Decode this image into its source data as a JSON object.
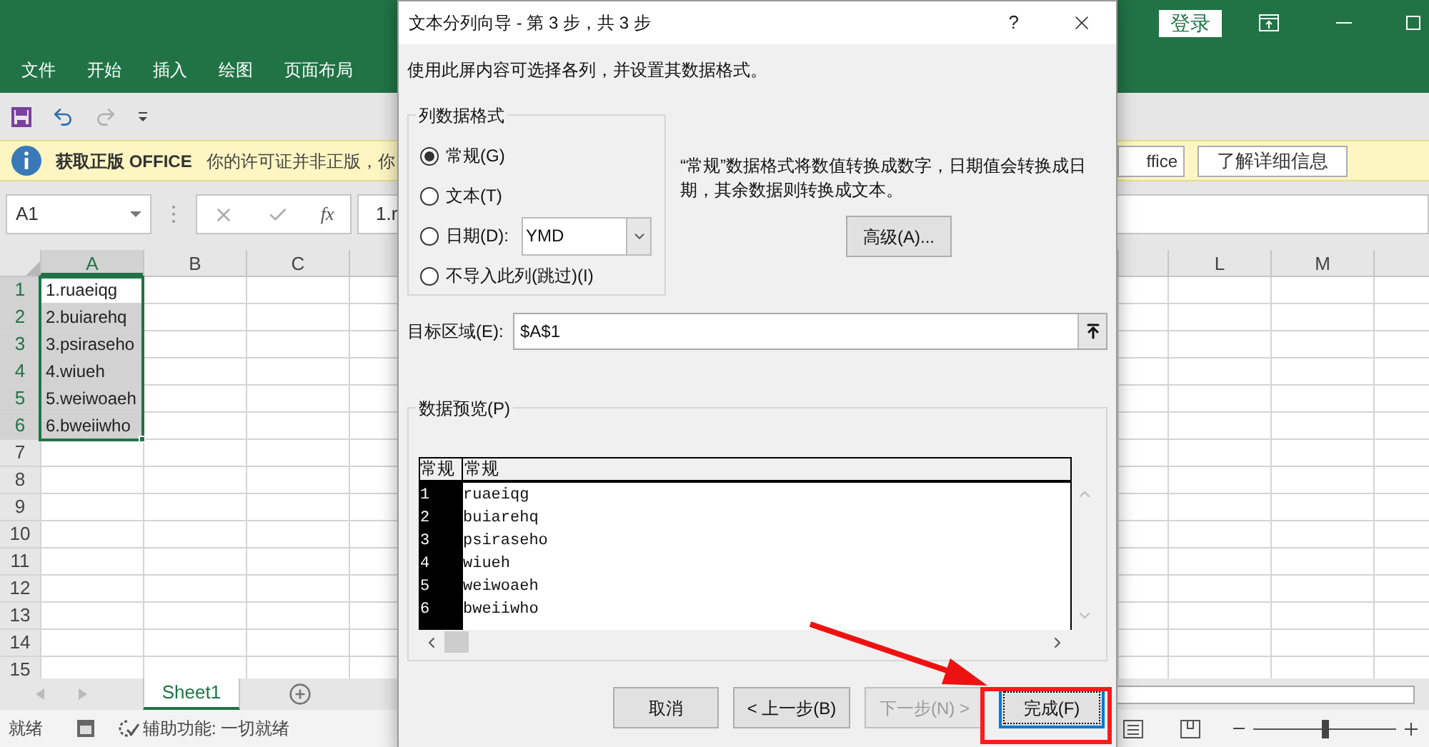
{
  "excel": {
    "title_bar": {
      "signin": "登录"
    },
    "ribbon_tabs": [
      "文件",
      "开始",
      "插入",
      "绘图",
      "页面布局"
    ],
    "message_bar": {
      "title": "获取正版 OFFICE",
      "text": "你的许可证并非正版，你",
      "buttons": [
        "ffice",
        "了解详细信息"
      ]
    },
    "name_box": "A1",
    "fx": "fx",
    "formula": "1.r",
    "columns_left": [
      "A",
      "B",
      "C"
    ],
    "columns_right": [
      "L",
      "M"
    ],
    "rows": [
      {
        "label": "1",
        "cell": {
          "text": "1.ruaeiqg",
          "selected": false
        }
      },
      {
        "label": "2",
        "cell": {
          "text": "2.buiarehq",
          "selected": true
        }
      },
      {
        "label": "3",
        "cell": {
          "text": "3.psiraseho",
          "selected": true
        }
      },
      {
        "label": "4",
        "cell": {
          "text": "4.wiueh",
          "selected": true
        }
      },
      {
        "label": "5",
        "cell": {
          "text": "5.weiwoaeh",
          "selected": true
        }
      },
      {
        "label": "6",
        "cell": {
          "text": "6.bweiiwho",
          "selected": true
        }
      },
      {
        "label": "7"
      },
      {
        "label": "8"
      },
      {
        "label": "9"
      },
      {
        "label": "10"
      },
      {
        "label": "11"
      },
      {
        "label": "12"
      },
      {
        "label": "13"
      },
      {
        "label": "14"
      },
      {
        "label": "15"
      }
    ],
    "sheet_tabs": [
      {
        "label": "Sheet1",
        "selected": true
      }
    ],
    "status": {
      "ready": "就绪",
      "accessibility": "辅助功能: 一切就绪"
    },
    "zoom": {
      "level": 0.5
    }
  },
  "dialog": {
    "title": "文本分列向导 - 第 3 步，共 3 步",
    "help": "?",
    "instruction": "使用此屏内容可选择各列，并设置其数据格式。",
    "format_group": {
      "label": "列数据格式",
      "options": [
        {
          "kind": "plain",
          "label": "常规(G)",
          "selected": true
        },
        {
          "kind": "plain",
          "label": "文本(T)",
          "selected": false
        },
        {
          "kind": "date",
          "label": "日期(D):",
          "selected": false,
          "value": "YMD"
        },
        {
          "kind": "plain",
          "label": "不导入此列(跳过)(I)",
          "selected": false
        }
      ]
    },
    "description": "“常规”数据格式将数值转换成数字，日期值会转换成日期，其余数据则转换成文本。",
    "advanced": "高级(A)...",
    "destination": {
      "label": "目标区域(E):",
      "value": "$A$1"
    },
    "preview": {
      "label": "数据预览(P)",
      "headers": [
        "常规",
        "常规"
      ],
      "rows": [
        {
          "num": "1",
          "value": "ruaeiqg"
        },
        {
          "num": "2",
          "value": "buiarehq"
        },
        {
          "num": "3",
          "value": "psiraseho"
        },
        {
          "num": "4",
          "value": "wiueh"
        },
        {
          "num": "5",
          "value": "weiwoaeh"
        },
        {
          "num": "6",
          "value": "bweiiwho"
        }
      ]
    },
    "buttons": [
      {
        "label": "取消",
        "disabled": false,
        "focused": false
      },
      {
        "label": "< 上一步(B)",
        "disabled": false,
        "focused": false
      },
      {
        "label": "下一步(N) >",
        "disabled": true,
        "focused": false
      },
      {
        "label": "完成(F)",
        "disabled": false,
        "focused": true
      }
    ]
  }
}
